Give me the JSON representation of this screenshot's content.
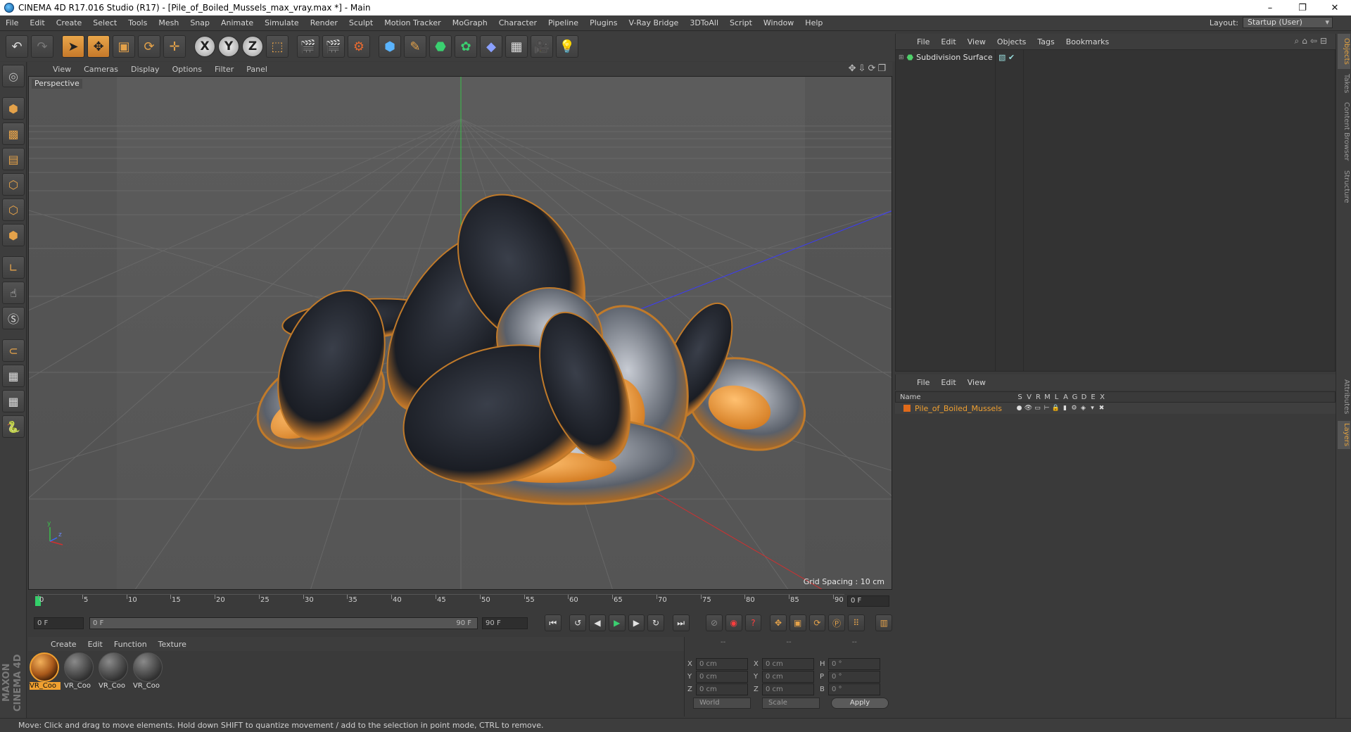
{
  "window": {
    "title": "CINEMA 4D R17.016 Studio (R17) - [Pile_of_Boiled_Mussels_max_vray.max *] - Main",
    "controls": [
      "–",
      "❐",
      "✕"
    ]
  },
  "menu": {
    "items": [
      "File",
      "Edit",
      "Create",
      "Select",
      "Tools",
      "Mesh",
      "Snap",
      "Animate",
      "Simulate",
      "Render",
      "Sculpt",
      "Motion Tracker",
      "MoGraph",
      "Character",
      "Pipeline",
      "Plugins",
      "V-Ray Bridge",
      "3DToAll",
      "Script",
      "Window",
      "Help"
    ],
    "layout_label": "Layout:",
    "layout_value": "Startup (User)"
  },
  "toolbar": {
    "axis_x": "X",
    "axis_y": "Y",
    "axis_z": "Z"
  },
  "viewport": {
    "menu": [
      "View",
      "Cameras",
      "Display",
      "Options",
      "Filter",
      "Panel"
    ],
    "label": "Perspective",
    "grid_spacing": "Grid Spacing : 10 cm",
    "axis_y": "y",
    "axis_z": "z"
  },
  "timeline": {
    "ticks": [
      "0",
      "5",
      "10",
      "15",
      "20",
      "25",
      "30",
      "35",
      "40",
      "45",
      "50",
      "55",
      "60",
      "65",
      "70",
      "75",
      "80",
      "85",
      "90"
    ],
    "current_frame": "0 F",
    "start_field": "0 F",
    "slider_start": "0 F",
    "slider_end": "90 F",
    "end_field": "90 F"
  },
  "materials": {
    "menu": [
      "Create",
      "Edit",
      "Function",
      "Texture"
    ],
    "items": [
      "VR_Coo",
      "VR_Coo",
      "VR_Coo",
      "VR_Coo"
    ]
  },
  "coordinates": {
    "headers": [
      "--",
      "--",
      "--"
    ],
    "rows": [
      {
        "a1": "X",
        "v1": "0 cm",
        "a2": "X",
        "v2": "0 cm",
        "a3": "H",
        "v3": "0 °"
      },
      {
        "a1": "Y",
        "v1": "0 cm",
        "a2": "Y",
        "v2": "0 cm",
        "a3": "P",
        "v3": "0 °"
      },
      {
        "a1": "Z",
        "v1": "0 cm",
        "a2": "Z",
        "v2": "0 cm",
        "a3": "B",
        "v3": "0 °"
      }
    ],
    "space": "World",
    "mode": "Scale",
    "apply": "Apply"
  },
  "objects": {
    "menu": [
      "File",
      "Edit",
      "View",
      "Objects",
      "Tags",
      "Bookmarks"
    ],
    "items": [
      {
        "name": "Subdivision Surface"
      }
    ]
  },
  "layers": {
    "menu": [
      "File",
      "Edit",
      "View"
    ],
    "name_header": "Name",
    "columns": [
      "S",
      "V",
      "R",
      "M",
      "L",
      "A",
      "G",
      "D",
      "E",
      "X"
    ],
    "rows": [
      {
        "name": "Pile_of_Boiled_Mussels"
      }
    ]
  },
  "side_tabs": [
    "Objects",
    "Takes",
    "Content Browser",
    "Structure",
    "Attributes",
    "Layers"
  ],
  "status": "Move: Click and drag to move elements. Hold down SHIFT to quantize movement / add to the selection in point mode, CTRL to remove.",
  "brand": "MAXON CINEMA 4D"
}
